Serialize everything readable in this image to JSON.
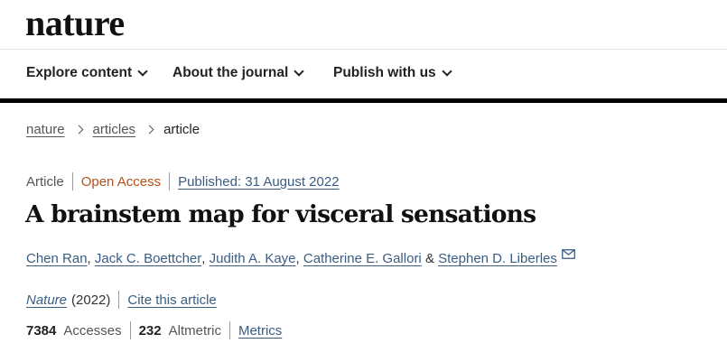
{
  "header": {
    "logo": "nature"
  },
  "nav": {
    "items": [
      {
        "label": "Explore content"
      },
      {
        "label": "About the journal"
      },
      {
        "label": "Publish with us"
      }
    ]
  },
  "breadcrumb": {
    "items": [
      "nature",
      "articles",
      "article"
    ]
  },
  "article": {
    "type": "Article",
    "access": "Open Access",
    "published": "Published: 31 August 2022",
    "title": "A brainstem map for visceral sensations",
    "authors": [
      "Chen Ran",
      "Jack C. Boettcher",
      "Judith A. Kaye",
      "Catherine E. Gallori",
      "Stephen D. Liberles"
    ],
    "author_separator": ", ",
    "author_last_separator": " & ",
    "journal": "Nature",
    "year": "(2022)",
    "cite_label": "Cite this article",
    "accesses_value": "7384",
    "accesses_label": "Accesses",
    "altmetric_value": "232",
    "altmetric_label": "Altmetric",
    "metrics_label": "Metrics"
  },
  "colors": {
    "link": "#3a5d84",
    "open_access": "#b5501b",
    "nav_rule": "#000000"
  },
  "icons": {
    "nav_dropdown": "chevron-down-icon",
    "breadcrumb_separator": "chevron-right-icon",
    "corresponding_author": "mail-icon"
  }
}
